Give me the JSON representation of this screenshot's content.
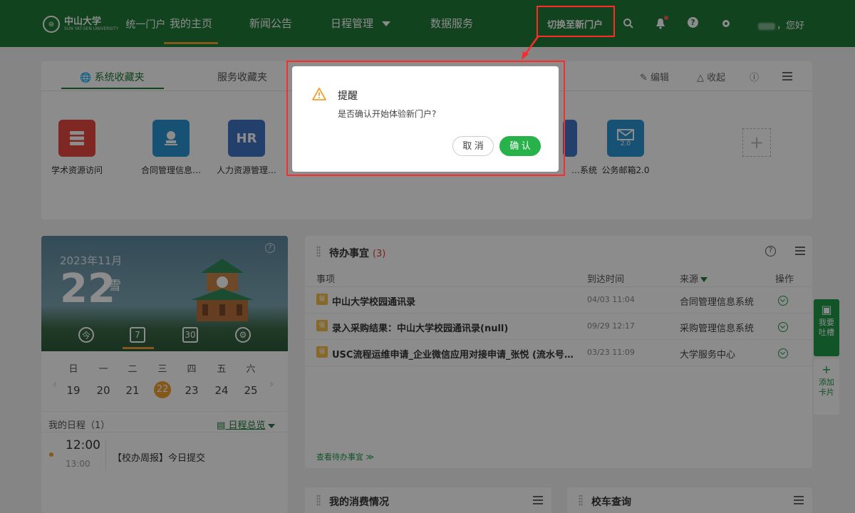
{
  "topbar": {
    "logo_text": "中山大学",
    "logo_sub": "SUN YAT-SEN UNIVERSITY",
    "portal_name": "统一门户",
    "nav": [
      {
        "label": "我的主页",
        "active": true
      },
      {
        "label": "新闻公告",
        "active": false
      },
      {
        "label": "日程管理",
        "active": false
      },
      {
        "label": "数据服务",
        "active": false
      }
    ],
    "switch_label": "切换至新门户",
    "greeting": "您好"
  },
  "favorites": {
    "tabs": [
      "系统收藏夹",
      "服务收藏夹"
    ],
    "actions": {
      "edit": "编辑",
      "collapse": "收起"
    },
    "apps": [
      {
        "label": "学术资源访问",
        "icon": "server-icon",
        "color": "#e8473e"
      },
      {
        "label": "合同管理信息…",
        "icon": "seal-icon",
        "color": "#2b95d6"
      },
      {
        "label": "人力资源管理…",
        "icon": "hr-icon",
        "color": "#3f76c4",
        "text": "HR"
      },
      {
        "label": "…系统",
        "icon": "app-icon",
        "color": "#3f76c4"
      },
      {
        "label": "公务邮箱2.0",
        "icon": "mail-icon",
        "color": "#2b95d6",
        "text": "2.0"
      }
    ]
  },
  "calendar": {
    "year_month": "2023年11月",
    "day": "22",
    "solar_term": "雪",
    "weekdays": [
      "日",
      "一",
      "二",
      "三",
      "四",
      "五",
      "六"
    ],
    "dates": [
      "19",
      "20",
      "21",
      "22",
      "23",
      "24",
      "25"
    ],
    "today_index": 3,
    "schedule_title": "我的日程（1）",
    "schedule_overview": "日程总览",
    "event": {
      "start": "12:00",
      "end": "13:00",
      "text": "【校办周报】今日提交"
    },
    "today_tool": "今"
  },
  "todo": {
    "title": "待办事宜",
    "count": "(3)",
    "columns": [
      "事项",
      "到达时间",
      "来源",
      "操作"
    ],
    "rows": [
      {
        "title": "中山大学校园通讯录",
        "time": "04/03 11:04",
        "source": "合同管理信息系统"
      },
      {
        "title": "录入采购结果：中山大学校园通讯录(null)",
        "time": "09/29 12:17",
        "source": "采购管理信息系统"
      },
      {
        "title": "USC流程运维申请_企业微信应用对接申请_张悦 (流水号…",
        "time": "03/23 11:09",
        "source": "大学服务中心"
      }
    ],
    "more_link": "查看待办事宜 ≫"
  },
  "side": {
    "feedback": "我要吐槽",
    "add_card": "添加卡片"
  },
  "bottom": {
    "spending": "我的消费情况",
    "bus": "校车查询"
  },
  "dialog": {
    "title": "提醒",
    "message": "是否确认开始体验新门户?",
    "cancel": "取 消",
    "ok": "确 认"
  }
}
